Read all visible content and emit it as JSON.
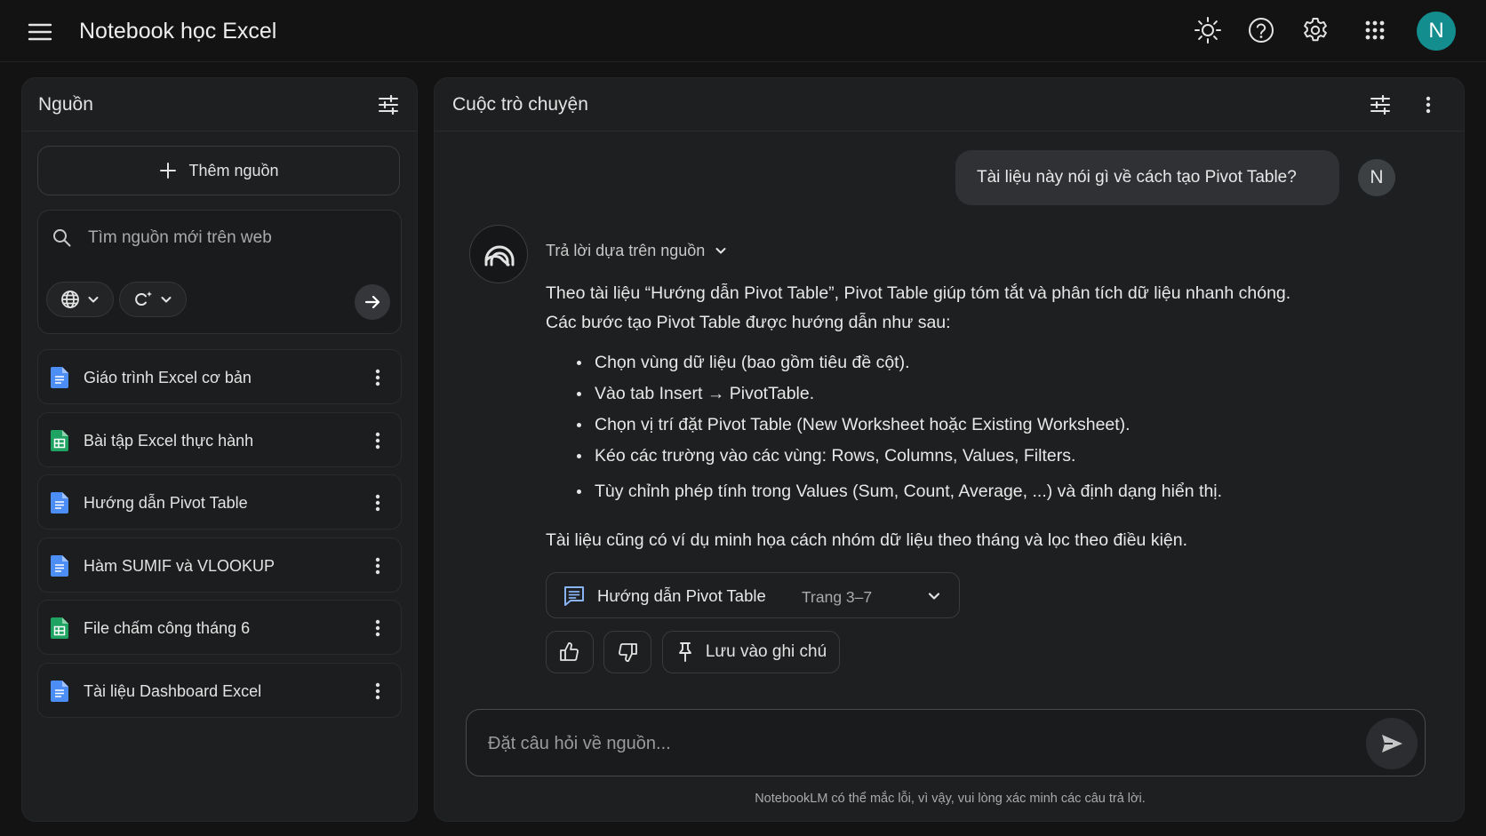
{
  "header": {
    "title": "Notebook học Excel",
    "avatar_letter": "N"
  },
  "sources_panel": {
    "title": "Nguồn",
    "add_button_label": "Thêm nguồn",
    "search_placeholder": "Tìm nguồn mới trên web",
    "items": [
      {
        "label": "Giáo trình Excel cơ bản",
        "type": "doc"
      },
      {
        "label": "Bài tập Excel thực hành",
        "type": "sheet"
      },
      {
        "label": "Hướng dẫn Pivot Table",
        "type": "doc"
      },
      {
        "label": "Hàm SUMIF và VLOOKUP",
        "type": "doc"
      },
      {
        "label": "File chấm công tháng 6",
        "type": "sheet"
      },
      {
        "label": "Tài liệu Dashboard Excel",
        "type": "doc"
      }
    ]
  },
  "chat_panel": {
    "title": "Cuộc trò chuyện",
    "user_message": "Tài liệu này nói gì về cách tạo Pivot Table?",
    "user_avatar_letter": "N",
    "answer_label": "Trả lời dựa trên nguồn",
    "answer_intro_1": "Theo tài liệu “Hướng dẫn Pivot Table”, Pivot Table giúp tóm tắt và phân tích dữ liệu nhanh chóng.",
    "answer_intro_2": "Các bước tạo Pivot Table được hướng dẫn như sau:",
    "steps": [
      "Chọn vùng dữ liệu (bao gồm tiêu đề cột).",
      "Vào tab Insert → PivotTable.",
      "Chọn vị trí đặt Pivot Table (New Worksheet hoặc Existing Worksheet).",
      "Kéo các trường vào các vùng: Rows, Columns, Values, Filters.",
      "Tùy chỉnh phép tính trong Values (Sum, Count, Average, ...) và định dạng hiển thị."
    ],
    "answer_closing": "Tài liệu cũng có ví dụ minh họa cách nhóm dữ liệu theo tháng và lọc theo điều kiện.",
    "citation": {
      "title": "Hướng dẫn Pivot Table",
      "pages": "Trang 3–7"
    },
    "save_note_label": "Lưu vào ghi chú",
    "input_placeholder": "Đặt câu hỏi về nguồn...",
    "disclaimer": "NotebookLM có thể mắc lỗi, vì vậy, vui lòng xác minh các câu trả lời."
  },
  "colors": {
    "background": "#131314",
    "panel": "#1e1f20",
    "avatar": "#138d8d",
    "doc_icon": "#4c8df6",
    "sheet_icon": "#1ea362"
  }
}
